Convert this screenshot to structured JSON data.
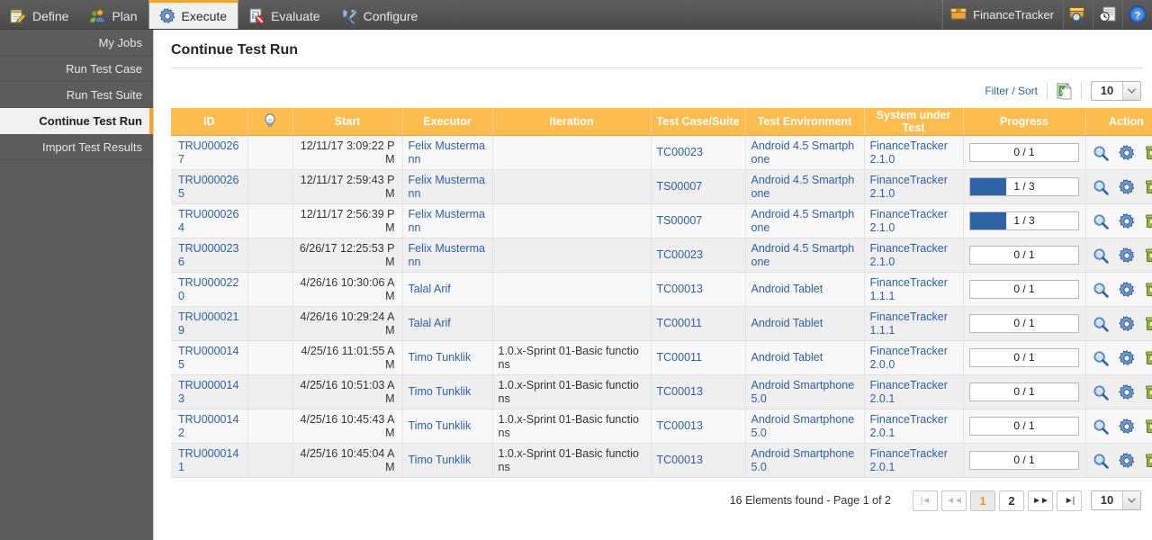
{
  "topnav": {
    "tabs": [
      {
        "label": "Define",
        "icon": "notepad-pencil-icon",
        "active": false
      },
      {
        "label": "Plan",
        "icon": "people-icon",
        "active": false
      },
      {
        "label": "Execute",
        "icon": "gear-icon",
        "active": true
      },
      {
        "label": "Evaluate",
        "icon": "report-chart-icon",
        "active": false
      },
      {
        "label": "Configure",
        "icon": "tools-icon",
        "active": false
      }
    ],
    "project": {
      "label": "FinanceTracker",
      "icon": "box-icon"
    },
    "icons": [
      {
        "name": "search-box-icon"
      },
      {
        "name": "history-report-icon"
      },
      {
        "name": "help-icon"
      }
    ]
  },
  "sidebar": {
    "items": [
      {
        "label": "My Jobs",
        "active": false
      },
      {
        "label": "Run Test Case",
        "active": false
      },
      {
        "label": "Run Test Suite",
        "active": false
      },
      {
        "label": "Continue Test Run",
        "active": true
      },
      {
        "label": "Import Test Results",
        "active": false
      }
    ]
  },
  "page": {
    "title": "Continue Test Run"
  },
  "toolbar": {
    "filter_sort_label": "Filter / Sort",
    "export_icon": "excel-export-icon",
    "page_size": "10"
  },
  "table": {
    "columns": [
      {
        "label": "ID",
        "icon": null
      },
      {
        "label": "",
        "icon": "lightbulb-icon"
      },
      {
        "label": "Start",
        "icon": null
      },
      {
        "label": "Executor",
        "icon": null
      },
      {
        "label": "Iteration",
        "icon": null
      },
      {
        "label": "Test Case/Suite",
        "icon": null
      },
      {
        "label": "Test Environment",
        "icon": null
      },
      {
        "label": "System under Test",
        "icon": null
      },
      {
        "label": "Progress",
        "icon": null
      },
      {
        "label": "Action",
        "icon": null
      }
    ],
    "action_icons": [
      {
        "name": "magnifier-icon"
      },
      {
        "name": "gear-icon"
      },
      {
        "name": "recycle-bin-icon"
      }
    ],
    "rows": [
      {
        "id": "TRU0000267",
        "bulb": "",
        "start": "12/11/17 3:09:22 PM",
        "executor": "Felix Mustermann",
        "iteration": "",
        "testcase": "TC00023",
        "environment": "Android 4.5 Smartphone",
        "sut": "FinanceTracker 2.1.0",
        "progress_text": "0 / 1",
        "progress_done": 0,
        "progress_total": 1
      },
      {
        "id": "TRU0000265",
        "bulb": "",
        "start": "12/11/17 2:59:43 PM",
        "executor": "Felix Mustermann",
        "iteration": "",
        "testcase": "TS00007",
        "environment": "Android 4.5 Smartphone",
        "sut": "FinanceTracker 2.1.0",
        "progress_text": "1 / 3",
        "progress_done": 1,
        "progress_total": 3
      },
      {
        "id": "TRU0000264",
        "bulb": "",
        "start": "12/11/17 2:56:39 PM",
        "executor": "Felix Mustermann",
        "iteration": "",
        "testcase": "TS00007",
        "environment": "Android 4.5 Smartphone",
        "sut": "FinanceTracker 2.1.0",
        "progress_text": "1 / 3",
        "progress_done": 1,
        "progress_total": 3
      },
      {
        "id": "TRU0000236",
        "bulb": "",
        "start": "6/26/17 12:25:53 PM",
        "executor": "Felix Mustermann",
        "iteration": "",
        "testcase": "TC00023",
        "environment": "Android 4.5 Smartphone",
        "sut": "FinanceTracker 2.1.0",
        "progress_text": "0 / 1",
        "progress_done": 0,
        "progress_total": 1
      },
      {
        "id": "TRU0000220",
        "bulb": "",
        "start": "4/26/16 10:30:06 AM",
        "executor": "Talal Arif",
        "iteration": "",
        "testcase": "TC00013",
        "environment": "Android Tablet",
        "sut": "FinanceTracker 1.1.1",
        "progress_text": "0 / 1",
        "progress_done": 0,
        "progress_total": 1
      },
      {
        "id": "TRU0000219",
        "bulb": "",
        "start": "4/26/16 10:29:24 AM",
        "executor": "Talal Arif",
        "iteration": "",
        "testcase": "TC00011",
        "environment": "Android Tablet",
        "sut": "FinanceTracker 1.1.1",
        "progress_text": "0 / 1",
        "progress_done": 0,
        "progress_total": 1
      },
      {
        "id": "TRU0000145",
        "bulb": "",
        "start": "4/25/16 11:01:55 AM",
        "executor": "Timo Tunklik",
        "iteration": "1.0.x-Sprint 01-Basic functions",
        "testcase": "TC00011",
        "environment": "Android Tablet",
        "sut": "FinanceTracker 2.0.0",
        "progress_text": "0 / 1",
        "progress_done": 0,
        "progress_total": 1
      },
      {
        "id": "TRU0000143",
        "bulb": "",
        "start": "4/25/16 10:51:03 AM",
        "executor": "Timo Tunklik",
        "iteration": "1.0.x-Sprint 01-Basic functions",
        "testcase": "TC00013",
        "environment": "Android Smartphone 5.0",
        "sut": "FinanceTracker 2.0.1",
        "progress_text": "0 / 1",
        "progress_done": 0,
        "progress_total": 1
      },
      {
        "id": "TRU0000142",
        "bulb": "",
        "start": "4/25/16 10:45:43 AM",
        "executor": "Timo Tunklik",
        "iteration": "1.0.x-Sprint 01-Basic functions",
        "testcase": "TC00013",
        "environment": "Android Smartphone 5.0",
        "sut": "FinanceTracker 2.0.1",
        "progress_text": "0 / 1",
        "progress_done": 0,
        "progress_total": 1
      },
      {
        "id": "TRU0000141",
        "bulb": "",
        "start": "4/25/16 10:45:04 AM",
        "executor": "Timo Tunklik",
        "iteration": "1.0.x-Sprint 01-Basic functions",
        "testcase": "TC00013",
        "environment": "Android Smartphone 5.0",
        "sut": "FinanceTracker 2.0.1",
        "progress_text": "0 / 1",
        "progress_done": 0,
        "progress_total": 1
      }
    ]
  },
  "pagination": {
    "summary": "16 Elements found - Page 1 of 2",
    "first_label": "|◄",
    "prev_label": "◄◄",
    "next_label": "►►",
    "last_label": "►|",
    "pages": [
      {
        "label": "1",
        "current": true
      },
      {
        "label": "2",
        "current": false
      }
    ],
    "page_size": "10"
  },
  "colors": {
    "accent_orange": "#f5a623",
    "header_orange": "#fcbc4e",
    "link_blue": "#2b5fa8",
    "progress_blue": "#2f63a8",
    "nav_dark": "#555555"
  }
}
